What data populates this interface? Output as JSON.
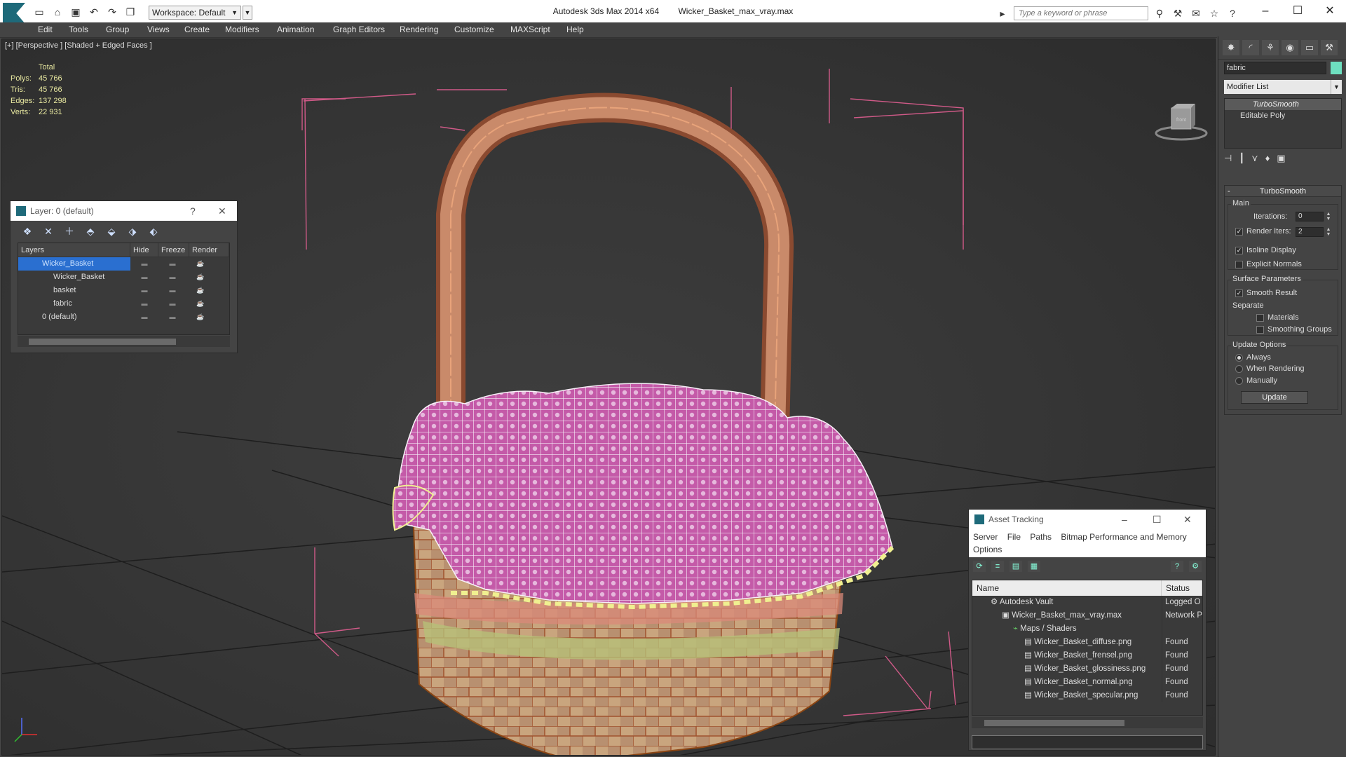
{
  "titlebar": {
    "app_name": "Autodesk 3ds Max  2014 x64",
    "file_name": "Wicker_Basket_max_vray.max",
    "workspace": "Workspace: Default",
    "search_placeholder": "Type a keyword or phrase"
  },
  "menu": [
    "Edit",
    "Tools",
    "Group",
    "Views",
    "Create",
    "Modifiers",
    "Animation",
    "Graph Editors",
    "Rendering",
    "Customize",
    "MAXScript",
    "Help"
  ],
  "viewport": {
    "label": "[+] [Perspective ] [Shaded + Edged Faces ]",
    "stats_header": "Total",
    "stats": [
      {
        "k": "Polys:",
        "v": "45 766"
      },
      {
        "k": "Tris:",
        "v": "45 766"
      },
      {
        "k": "Edges:",
        "v": "137 298"
      },
      {
        "k": "Verts:",
        "v": "22 931"
      }
    ],
    "viewcube_label": "front"
  },
  "layer_window": {
    "title": "Layer: 0 (default)",
    "help": "?",
    "close": "✕",
    "columns": [
      "Layers",
      "Hide",
      "Freeze",
      "Render"
    ],
    "rows": [
      {
        "name": "Wicker_Basket",
        "selected": true
      },
      {
        "name": "Wicker_Basket",
        "selected": false
      },
      {
        "name": "basket",
        "selected": false
      },
      {
        "name": "fabric",
        "selected": false
      },
      {
        "name": "0 (default)",
        "selected": false
      }
    ]
  },
  "command_panel": {
    "object_name": "fabric",
    "object_color": "#6ee0c0",
    "modifier_list": "Modifier List",
    "stack": [
      "TurboSmooth",
      "Editable Poly"
    ],
    "rollout_title": "TurboSmooth",
    "main_label": "Main",
    "iterations_label": "Iterations:",
    "iterations_value": "0",
    "render_iters_label": "Render Iters:",
    "render_iters_value": "2",
    "isoline_label": "Isoline Display",
    "explicit_normals_label": "Explicit Normals",
    "surface_label": "Surface Parameters",
    "smooth_result_label": "Smooth Result",
    "separate_label": "Separate",
    "materials_label": "Materials",
    "smoothing_groups_label": "Smoothing Groups",
    "update_options_label": "Update Options",
    "always_label": "Always",
    "when_rendering_label": "When Rendering",
    "manually_label": "Manually",
    "update_button": "Update"
  },
  "asset_window": {
    "title": "Asset Tracking",
    "menu": [
      "Server",
      "File",
      "Paths",
      "Bitmap Performance and Memory"
    ],
    "menu2": "Options",
    "columns": [
      "Name",
      "Status"
    ],
    "rows": [
      {
        "name": "Autodesk Vault",
        "status": "Logged O",
        "indent": 1
      },
      {
        "name": "Wicker_Basket_max_vray.max",
        "status": "Network P",
        "indent": 2
      },
      {
        "name": "Maps / Shaders",
        "status": "",
        "indent": 3
      },
      {
        "name": "Wicker_Basket_diffuse.png",
        "status": "Found",
        "indent": 4
      },
      {
        "name": "Wicker_Basket_frensel.png",
        "status": "Found",
        "indent": 4
      },
      {
        "name": "Wicker_Basket_glossiness.png",
        "status": "Found",
        "indent": 4
      },
      {
        "name": "Wicker_Basket_normal.png",
        "status": "Found",
        "indent": 4
      },
      {
        "name": "Wicker_Basket_specular.png",
        "status": "Found",
        "indent": 4
      }
    ]
  }
}
